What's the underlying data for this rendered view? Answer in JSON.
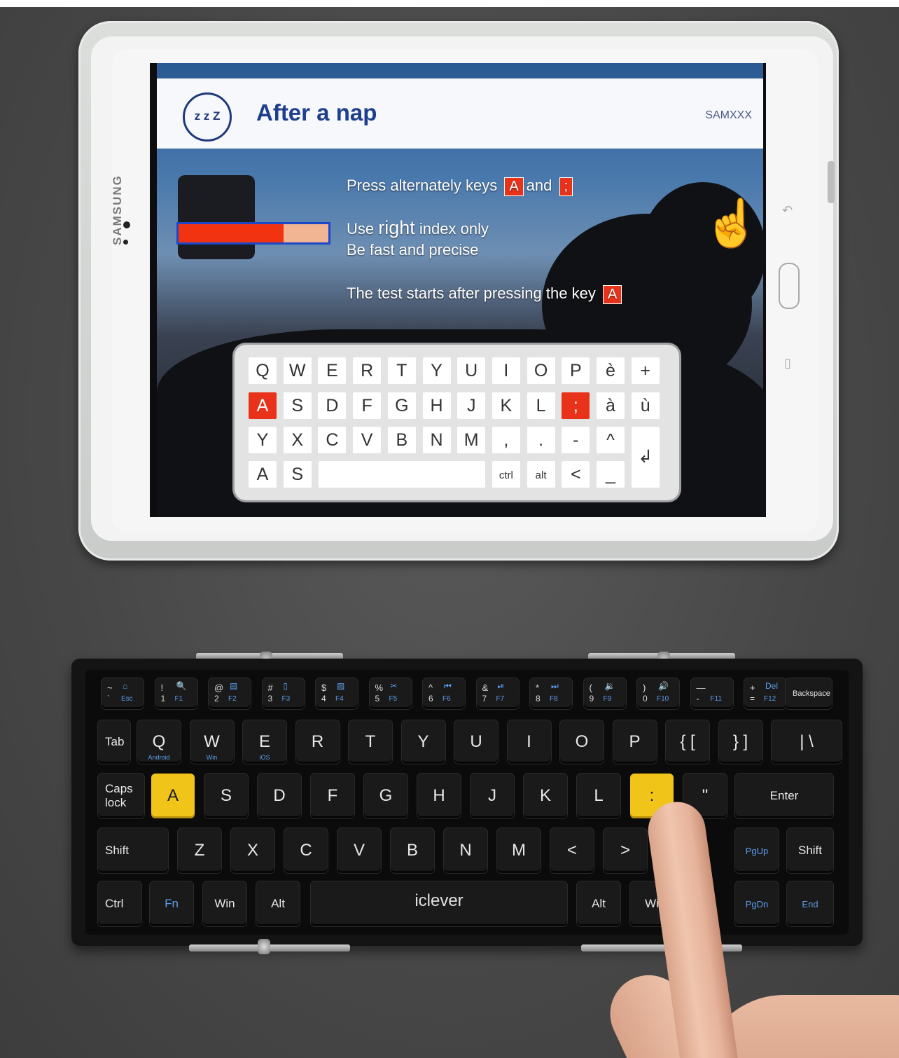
{
  "header": {
    "title": "After a nap",
    "logo_text": "z z Z",
    "participant_id": "SAMXXX"
  },
  "device": {
    "brand": "SAMSUNG"
  },
  "instructions": {
    "line1_prefix": "Press alternately keys",
    "key1": "A",
    "line1_and": "and",
    "key2": ";",
    "line2_prefix": "Use",
    "line2_emph": "right",
    "line2_suffix": "index only",
    "line3": "Be fast and precise",
    "line4_prefix": "The test starts after pressing the key",
    "key3": "A"
  },
  "progress": {
    "fraction": 0.7
  },
  "virtual_keyboard": {
    "row1": [
      "Q",
      "W",
      "E",
      "R",
      "T",
      "Y",
      "U",
      "I",
      "O",
      "P",
      "è",
      "+"
    ],
    "row2": [
      "A",
      "S",
      "D",
      "F",
      "G",
      "H",
      "J",
      "K",
      "L",
      ";",
      "à",
      "ù"
    ],
    "row3": [
      "Y",
      "X",
      "C",
      "V",
      "B",
      "N",
      "M",
      ",",
      ".",
      "-",
      "^"
    ],
    "row4_left": [
      "A",
      "S"
    ],
    "row4_right": [
      "ctrl",
      "alt",
      "<",
      "_"
    ],
    "enter_glyph": "↲",
    "highlighted": [
      "A",
      ";"
    ]
  },
  "physical_keyboard": {
    "brand_text": "iclever",
    "fn_row": [
      {
        "top": "~",
        "topr": "⌂",
        "bot": "`",
        "botr": "Esc"
      },
      {
        "top": "!",
        "topr": "🔍",
        "bot": "1",
        "botr": "F1"
      },
      {
        "top": "@",
        "topr": "▤",
        "bot": "2",
        "botr": "F2"
      },
      {
        "top": "#",
        "topr": "▯",
        "bot": "3",
        "botr": "F3"
      },
      {
        "top": "$",
        "topr": "▨",
        "bot": "4",
        "botr": "F4"
      },
      {
        "top": "%",
        "topr": "✂",
        "bot": "5",
        "botr": "F5"
      },
      {
        "top": "^",
        "topr": "⏮",
        "bot": "6",
        "botr": "F6"
      },
      {
        "top": "&",
        "topr": "⏯",
        "bot": "7",
        "botr": "F7"
      },
      {
        "top": "*",
        "topr": "⏭",
        "bot": "8",
        "botr": "F8"
      },
      {
        "top": "(",
        "topr": "🔉",
        "bot": "9",
        "botr": "F9"
      },
      {
        "top": ")",
        "topr": "🔊",
        "bot": "0",
        "botr": "F10"
      },
      {
        "top": "—",
        "topr": "",
        "bot": "-",
        "botr": "F11"
      },
      {
        "top": "+",
        "topr": "Del",
        "bot": "=",
        "botr": "F12"
      }
    ],
    "backspace_label": "Backspace",
    "tab_label": "Tab",
    "row_q": [
      {
        "main": "Q",
        "sub": "Android"
      },
      {
        "main": "W",
        "sub": "Win"
      },
      {
        "main": "E",
        "sub": "iOS"
      },
      {
        "main": "R",
        "sub": ""
      },
      {
        "main": "T",
        "sub": ""
      },
      {
        "main": "Y",
        "sub": ""
      },
      {
        "main": "U",
        "sub": ""
      },
      {
        "main": "I",
        "sub": ""
      },
      {
        "main": "O",
        "sub": ""
      },
      {
        "main": "P",
        "sub": ""
      },
      {
        "main": "{ [",
        "sub": ""
      },
      {
        "main": "} ]",
        "sub": ""
      },
      {
        "main": "| \\",
        "sub": ""
      }
    ],
    "caps_label": "Caps lock",
    "row_a": [
      "A",
      "S",
      "D",
      "F",
      "G",
      "H",
      "J",
      "K",
      "L",
      ":",
      "\""
    ],
    "enter_label": "Enter",
    "shift_label": "Shift",
    "row_z": [
      "Z",
      "X",
      "C",
      "V",
      "B",
      "N",
      "M",
      "<",
      ">"
    ],
    "pgup_label": "PgUp",
    "pgdn_label": "PgDn",
    "end_label": "End",
    "ctrl_label": "Ctrl",
    "fn_label": "Fn",
    "win_label": "Win",
    "alt_label": "Alt",
    "alt_right_label": "Alt",
    "win_right_label": "Wi",
    "highlighted": [
      "A",
      ":"
    ]
  }
}
